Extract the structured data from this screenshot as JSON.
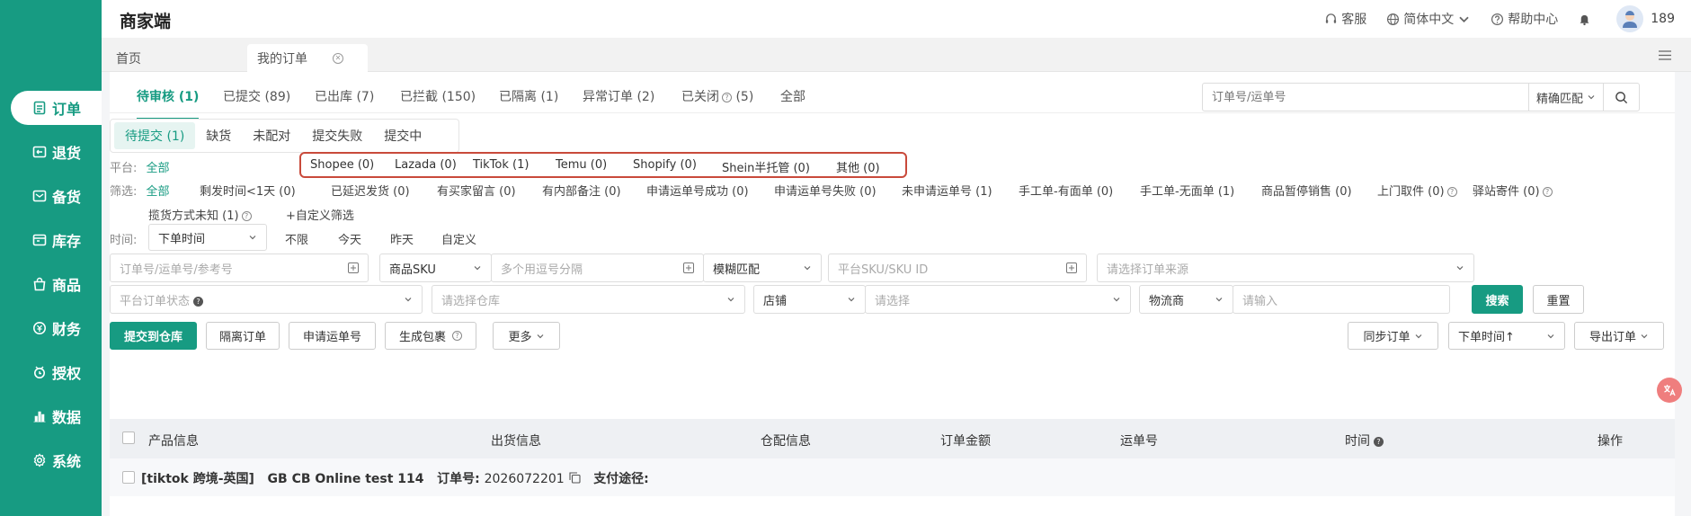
{
  "header": {
    "title": "商家端",
    "support": "客服",
    "language": "简体中文",
    "help": "帮助中心",
    "user_count": "189"
  },
  "page_tabs": [
    {
      "label": "首页"
    },
    {
      "label": "我的订单"
    }
  ],
  "sidebar": {
    "items": [
      {
        "label": "订单",
        "icon": "order-icon"
      },
      {
        "label": "退货",
        "icon": "return-icon"
      },
      {
        "label": "备货",
        "icon": "stock-prep-icon"
      },
      {
        "label": "库存",
        "icon": "inventory-icon"
      },
      {
        "label": "商品",
        "icon": "product-icon"
      },
      {
        "label": "财务",
        "icon": "finance-icon"
      },
      {
        "label": "授权",
        "icon": "auth-icon"
      },
      {
        "label": "数据",
        "icon": "data-icon"
      },
      {
        "label": "系统",
        "icon": "settings-icon"
      }
    ]
  },
  "status_tabs": [
    "待审核 (1)",
    "已提交 (89)",
    "已出库 (7)",
    "已拦截 (150)",
    "已隔离 (1)",
    "异常订单 (2)",
    "已关闭",
    "(5)",
    "全部"
  ],
  "search": {
    "placeholder": "订单号/运单号",
    "match": "精确匹配"
  },
  "sub_tabs": [
    "待提交 (1)",
    "缺货",
    "未配对",
    "提交失败",
    "提交中"
  ],
  "platform": {
    "label": "平台:",
    "all": "全部",
    "items": [
      "Shopee (0)",
      "Lazada (0)",
      "TikTok (1)",
      "Temu (0)",
      "Shopify (0)",
      "Shein半托管 (0)",
      "其他 (0)"
    ]
  },
  "filter": {
    "label": "筛选:",
    "all": "全部",
    "items": [
      "剩发时间<1天 (0)",
      "已延迟发货 (0)",
      "有买家留言 (0)",
      "有内部备注 (0)",
      "申请运单号成功 (0)",
      "申请运单号失败 (0)",
      "未申请运单号 (1)",
      "手工单-有面单 (0)",
      "手工单-无面单 (1)",
      "商品暂停销售 (0)",
      "上门取件 (0)",
      "驿站寄件 (0)",
      "揽货方式未知 (1)"
    ],
    "custom": "+自定义筛选"
  },
  "time": {
    "label": "时间:",
    "select": "下单时间",
    "options": [
      "不限",
      "今天",
      "昨天",
      "自定义"
    ]
  },
  "fields": {
    "order_ref": "订单号/运单号/参考号",
    "sku_select": "商品SKU",
    "sku_input": "多个用逗号分隔",
    "fuzzy": "模糊匹配",
    "platform_sku": "平台SKU/SKU ID",
    "order_source": "请选择订单来源",
    "platform_status": "平台订单状态",
    "warehouse": "请选择仓库",
    "store_label": "店铺",
    "store_select": "请选择",
    "carrier_label": "物流商",
    "carrier_input": "请输入",
    "search_btn": "搜索",
    "reset_btn": "重置"
  },
  "actions": {
    "submit": "提交到仓库",
    "isolate": "隔离订单",
    "apply_waybill": "申请运单号",
    "gen_package": "生成包裹",
    "more": "更多",
    "sync": "同步订单",
    "sort": "下单时间↑",
    "export": "导出订单"
  },
  "table": {
    "headers": [
      "产品信息",
      "出货信息",
      "仓配信息",
      "订单金额",
      "运单号",
      "时间",
      "操作"
    ],
    "group": {
      "shop": "[tiktok 跨境-英国]",
      "store": "GB CB Online test 114",
      "order_label": "订单号:",
      "order_no": "2026072201",
      "pay_label": "支付途径:"
    }
  }
}
